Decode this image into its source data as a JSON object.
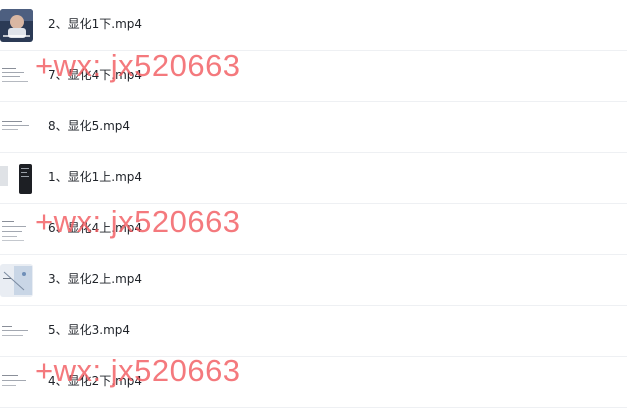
{
  "files": [
    {
      "name": "2、显化1下.mp4",
      "thumbnail": "video-thumbnail-person"
    },
    {
      "name": "7、显化4下.mp4",
      "thumbnail": "video-thumbnail-text"
    },
    {
      "name": "8、显化5.mp4",
      "thumbnail": "video-thumbnail-text"
    },
    {
      "name": "1、显化1上.mp4",
      "thumbnail": "video-thumbnail-dark"
    },
    {
      "name": "6、显化4上.mp4",
      "thumbnail": "video-thumbnail-text"
    },
    {
      "name": "3、显化2上.mp4",
      "thumbnail": "video-thumbnail-diagram"
    },
    {
      "name": "5、显化3.mp4",
      "thumbnail": "video-thumbnail-text"
    },
    {
      "name": "4、显化2下.mp4",
      "thumbnail": "video-thumbnail-text"
    }
  ],
  "watermark": {
    "text": "+wx: jx520663",
    "color": "#f15c60"
  }
}
